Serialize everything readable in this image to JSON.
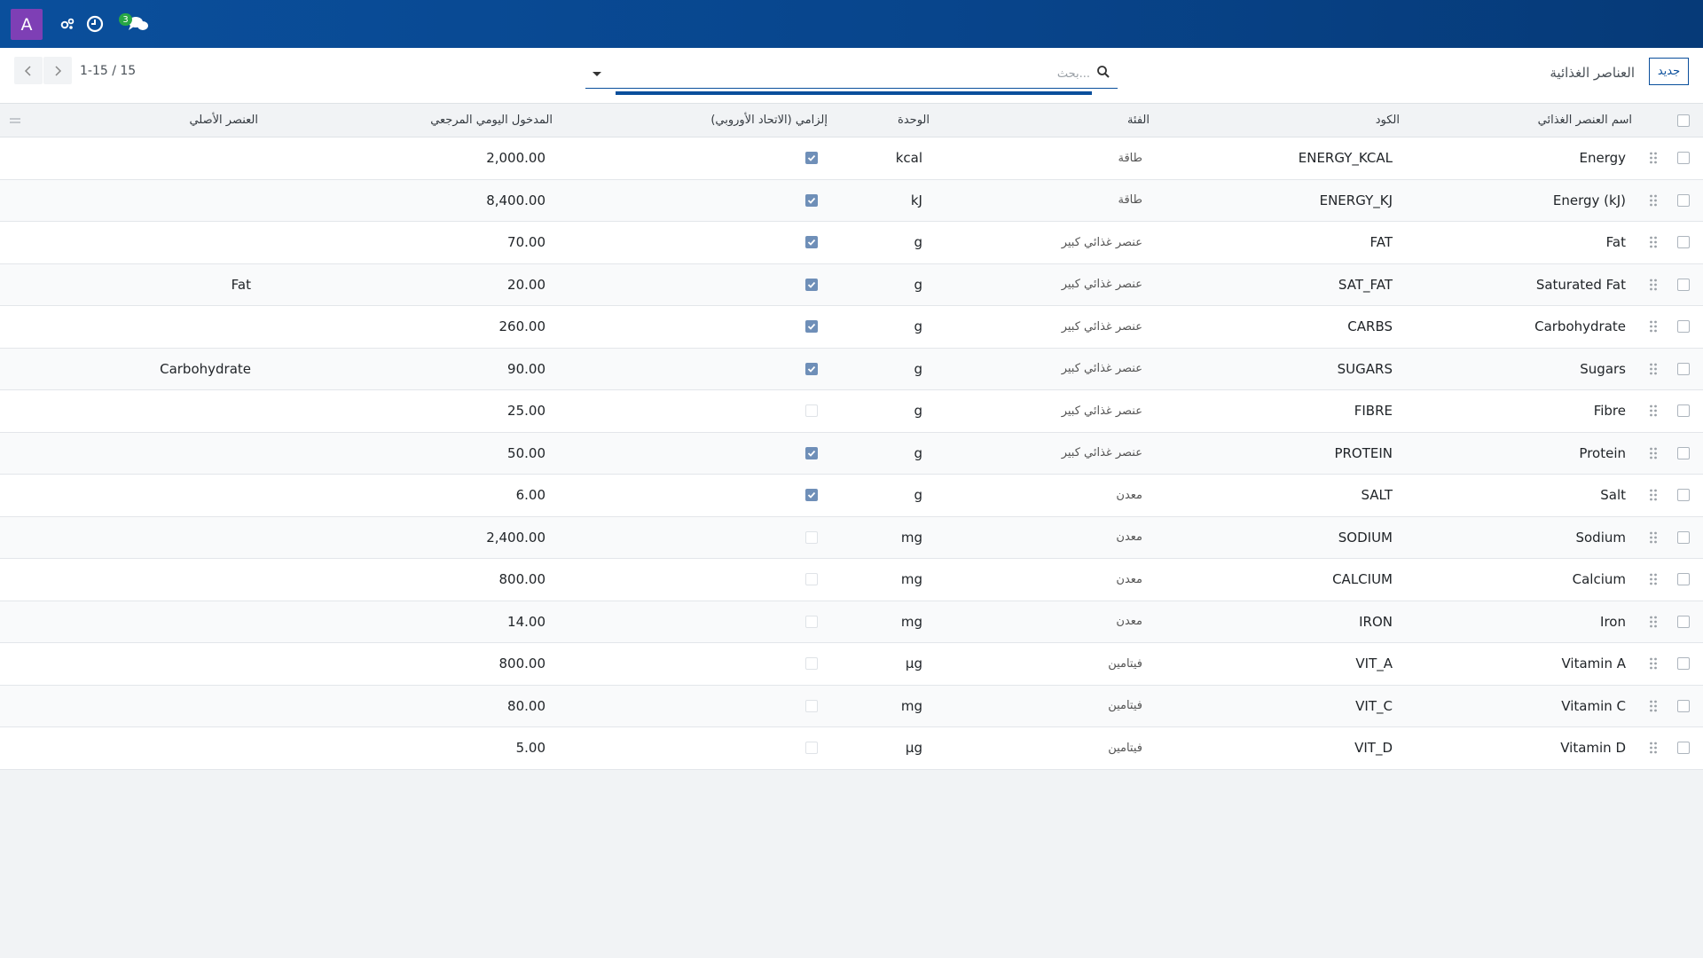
{
  "navbar": {
    "avatar_letter": "A",
    "icons": [
      "activity-icon",
      "clock-icon",
      "chat-icon"
    ],
    "chat_badge": "3"
  },
  "control": {
    "new_button": "جديد",
    "breadcrumb": "العناصر الغذائية",
    "search_placeholder": "بحث...",
    "pager_value": "1-15 / 15"
  },
  "table": {
    "headers": {
      "name": "اسم العنصر الغذائي",
      "code": "الكود",
      "category": "الفئة",
      "unit": "الوحدة",
      "mandatory": "إلزامي (الاتحاد الأوروبي)",
      "reference_intake": "المدخول اليومي المرجعي",
      "parent": "العنصر الأصلي"
    },
    "rows": [
      {
        "name": "Energy",
        "code": "ENERGY_KCAL",
        "category": "طاقة",
        "unit": "kcal",
        "mandatory": true,
        "intake": "2,000.00",
        "parent": ""
      },
      {
        "name": "Energy (kJ)",
        "code": "ENERGY_KJ",
        "category": "طاقة",
        "unit": "kJ",
        "mandatory": true,
        "intake": "8,400.00",
        "parent": ""
      },
      {
        "name": "Fat",
        "code": "FAT",
        "category": "عنصر غذائي كبير",
        "unit": "g",
        "mandatory": true,
        "intake": "70.00",
        "parent": ""
      },
      {
        "name": "Saturated Fat",
        "code": "SAT_FAT",
        "category": "عنصر غذائي كبير",
        "unit": "g",
        "mandatory": true,
        "intake": "20.00",
        "parent": "Fat"
      },
      {
        "name": "Carbohydrate",
        "code": "CARBS",
        "category": "عنصر غذائي كبير",
        "unit": "g",
        "mandatory": true,
        "intake": "260.00",
        "parent": ""
      },
      {
        "name": "Sugars",
        "code": "SUGARS",
        "category": "عنصر غذائي كبير",
        "unit": "g",
        "mandatory": true,
        "intake": "90.00",
        "parent": "Carbohydrate"
      },
      {
        "name": "Fibre",
        "code": "FIBRE",
        "category": "عنصر غذائي كبير",
        "unit": "g",
        "mandatory": false,
        "intake": "25.00",
        "parent": ""
      },
      {
        "name": "Protein",
        "code": "PROTEIN",
        "category": "عنصر غذائي كبير",
        "unit": "g",
        "mandatory": true,
        "intake": "50.00",
        "parent": ""
      },
      {
        "name": "Salt",
        "code": "SALT",
        "category": "معدن",
        "unit": "g",
        "mandatory": true,
        "intake": "6.00",
        "parent": ""
      },
      {
        "name": "Sodium",
        "code": "SODIUM",
        "category": "معدن",
        "unit": "mg",
        "mandatory": false,
        "intake": "2,400.00",
        "parent": ""
      },
      {
        "name": "Calcium",
        "code": "CALCIUM",
        "category": "معدن",
        "unit": "mg",
        "mandatory": false,
        "intake": "800.00",
        "parent": ""
      },
      {
        "name": "Iron",
        "code": "IRON",
        "category": "معدن",
        "unit": "mg",
        "mandatory": false,
        "intake": "14.00",
        "parent": ""
      },
      {
        "name": "Vitamin A",
        "code": "VIT_A",
        "category": "فيتامين",
        "unit": "µg",
        "mandatory": false,
        "intake": "800.00",
        "parent": ""
      },
      {
        "name": "Vitamin C",
        "code": "VIT_C",
        "category": "فيتامين",
        "unit": "mg",
        "mandatory": false,
        "intake": "80.00",
        "parent": ""
      },
      {
        "name": "Vitamin D",
        "code": "VIT_D",
        "category": "فيتامين",
        "unit": "µg",
        "mandatory": false,
        "intake": "5.00",
        "parent": ""
      }
    ]
  }
}
